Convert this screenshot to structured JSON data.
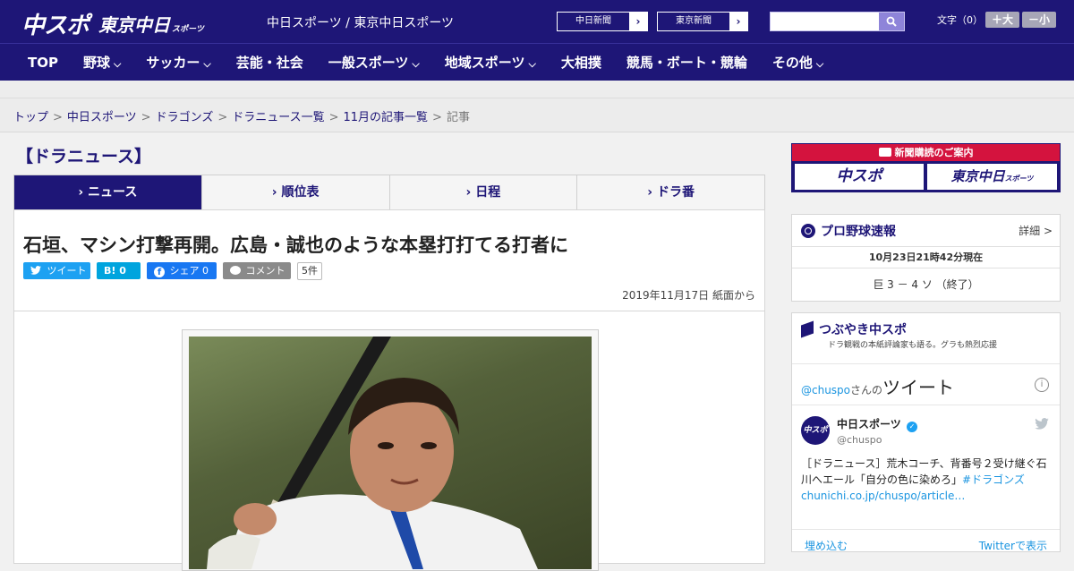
{
  "header": {
    "logo_main": "中スポ",
    "logo_tokyo": "東京中日",
    "logo_tokyo_small": "スポーツ",
    "site_title": "中日スポーツ / 東京中日スポーツ",
    "link1_label": "中日新聞",
    "link2_label": "東京新聞",
    "search_placeholder": "",
    "font_size_label": "文字（0）",
    "font_bigger": "＋大",
    "font_smaller": "－小"
  },
  "nav": {
    "items": [
      {
        "label": "TOP",
        "chevron": ""
      },
      {
        "label": "野球",
        "chevron": "⌵"
      },
      {
        "label": "サッカー",
        "chevron": "⌵"
      },
      {
        "label": "芸能・社会",
        "chevron": ""
      },
      {
        "label": "一般スポーツ",
        "chevron": "⌵"
      },
      {
        "label": "地域スポーツ",
        "chevron": "⌵"
      },
      {
        "label": "大相撲",
        "chevron": ""
      },
      {
        "label": "競馬・ボート・競輪",
        "chevron": ""
      },
      {
        "label": "その他",
        "chevron": "⌵"
      }
    ]
  },
  "breadcrumb": {
    "items": [
      "トップ",
      "中日スポーツ",
      "ドラゴンズ",
      "ドラニュース一覧",
      "11月の記事一覧"
    ],
    "current": "記事",
    "separator": ">"
  },
  "main": {
    "section_title": "【ドラニュース】",
    "tabs": [
      "ニュース",
      "順位表",
      "日程",
      "ドラ番"
    ],
    "headline": "石垣、マシン打撃再開。広島・誠也のような本塁打打てる打者に",
    "share": {
      "tweet_label": "ツイート",
      "hatena_label": "B! 0",
      "facebook_label": "シェア 0",
      "comment_label": "コメント",
      "comment_count": "5件"
    },
    "date": "2019年11月17日 紙面から"
  },
  "sidebar": {
    "subscribe_title": "新聞購読のご案内",
    "subscribe_btn1": "中スポ",
    "subscribe_btn2": "東京中日",
    "subscribe_btn2_small": "スポーツ",
    "scores": {
      "title": "プロ野球速報",
      "more": "詳細 >",
      "time": "10月23日21時42分現在",
      "line": "巨 3 － 4 ソ （終了）"
    },
    "tweets": {
      "title": "つぶやき中スポ",
      "subtitle": "ドラ観戦の本紙評論家も語る。グラも熱烈応援",
      "embed_prefix": "@chuspo",
      "embed_prefix2": "さんの",
      "embed_title": "ツイート",
      "account_name": "中日スポーツ",
      "account_handle": "@chuspo",
      "avatar_text": "中スポ",
      "text": "［ドラニュース］荒木コーチ、背番号２受け継ぐ石川へエール「自分の色に染めろ」",
      "hashtag": "#ドラゴンズ",
      "link": "chunichi.co.jp/chuspo/article…",
      "embed_link": "埋め込む",
      "view_link": "Twitterで表示"
    }
  },
  "colors": {
    "brand": "#1e1677",
    "accent_red": "#d4133e",
    "twitter": "#1da1f2",
    "hatena": "#00a4de",
    "facebook": "#1877f2"
  }
}
